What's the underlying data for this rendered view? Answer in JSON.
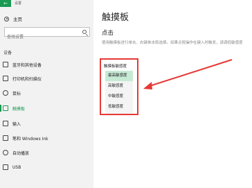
{
  "window": {
    "title": "设置",
    "back_icon": "back-arrow-icon"
  },
  "sidebar": {
    "home_label": "主页",
    "search_placeholder": "查找设置",
    "section_label": "设备",
    "items": [
      {
        "label": "蓝牙和其他设备",
        "icon": "bluetooth-icon",
        "active": false
      },
      {
        "label": "打印机和扫描仪",
        "icon": "printer-icon",
        "active": false
      },
      {
        "label": "鼠标",
        "icon": "mouse-icon",
        "active": false
      },
      {
        "label": "触摸板",
        "icon": "touchpad-icon",
        "active": true
      },
      {
        "label": "输入",
        "icon": "keyboard-icon",
        "active": false
      },
      {
        "label": "笔和 Windows Ink",
        "icon": "pen-icon",
        "active": false
      },
      {
        "label": "自动播放",
        "icon": "autoplay-icon",
        "active": false
      },
      {
        "label": "USB",
        "icon": "usb-icon",
        "active": false
      }
    ]
  },
  "main": {
    "title": "触摸板",
    "subtitle": "点击",
    "description": "使用触摸板进行单击、右键单击和选择。如果点按操作在键入时触发，请调低敏感度",
    "sensitivity_label": "触摸板敏感度",
    "options": [
      "最高敏感度",
      "高敏感度",
      "中敏感度",
      "低敏感度"
    ],
    "selected_option": "最高敏感度"
  },
  "colors": {
    "accent": "#1a9a52",
    "highlight": "#e53935",
    "selected_bg": "#c7ead5"
  }
}
